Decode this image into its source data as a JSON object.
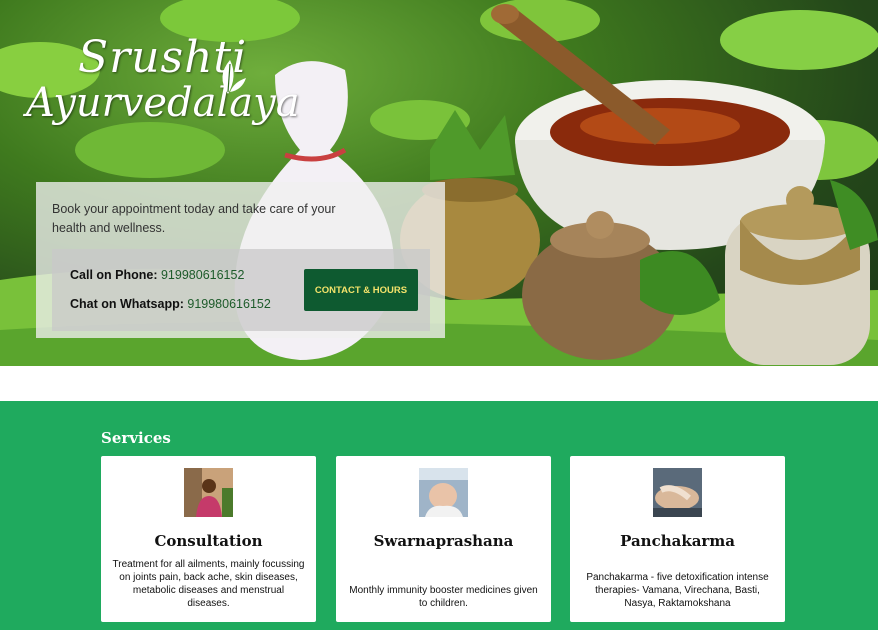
{
  "brand": {
    "line1": "Srushti",
    "line2": "Ayurvedalaya"
  },
  "booking": {
    "text": "Book your appointment today and take care of your health and wellness.",
    "phone_label": "Call on Phone:",
    "phone_number": "919980616152",
    "whatsapp_label": "Chat on Whatsapp:",
    "whatsapp_number": "919980616152",
    "button_label": "CONTACT & HOURS"
  },
  "services": {
    "title": "Services",
    "items": [
      {
        "title": "Consultation",
        "description": "Treatment for all ailments, mainly focussing on joints pain, back ache, skin diseases, metabolic diseases and menstrual diseases."
      },
      {
        "title": "Swarnaprashana",
        "description": "Monthly immunity booster medicines given to children."
      },
      {
        "title": "Panchakarma",
        "description": "Panchakarma - five detoxification intense therapies- Vamana, Virechana, Basti, Nasya, Raktamokshana"
      }
    ]
  },
  "colors": {
    "green": "#1faa5e",
    "button": "#0e5a30",
    "button_text": "#f3e26a"
  }
}
